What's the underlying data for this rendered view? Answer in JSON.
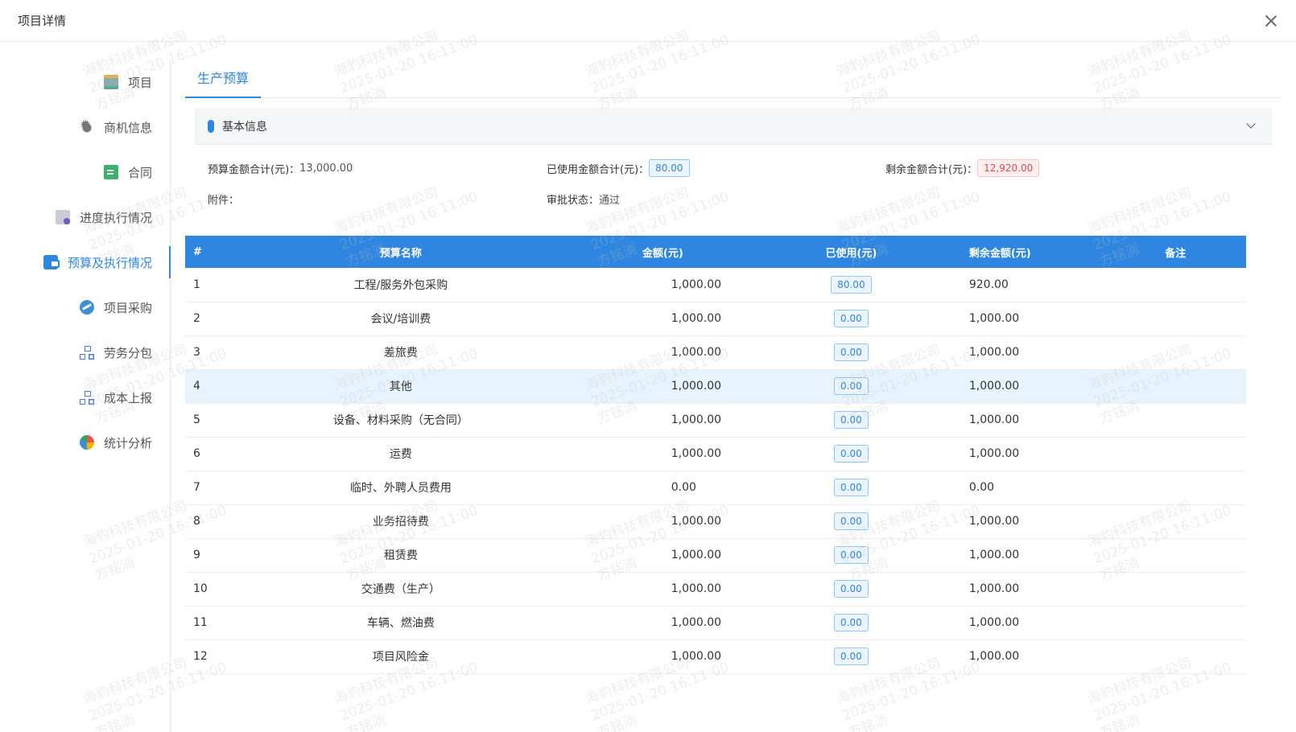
{
  "header": {
    "title": "项目详情"
  },
  "sidebar": {
    "items": [
      {
        "label": "项目",
        "icon": "book-icon"
      },
      {
        "label": "商机信息",
        "icon": "bug-icon"
      },
      {
        "label": "合同",
        "icon": "document-icon"
      },
      {
        "label": "进度执行情况",
        "icon": "list-icon"
      },
      {
        "label": "预算及执行情况",
        "icon": "wallet-icon",
        "active": true
      },
      {
        "label": "项目采购",
        "icon": "purchase-icon"
      },
      {
        "label": "劳务分包",
        "icon": "org-chart-icon"
      },
      {
        "label": "成本上报",
        "icon": "org-chart-icon"
      },
      {
        "label": "统计分析",
        "icon": "pie-chart-icon"
      }
    ]
  },
  "tabs": [
    {
      "label": "生产预算"
    }
  ],
  "section": {
    "title": "基本信息"
  },
  "info": {
    "budget_total_label": "预算金额合计(元)：",
    "budget_total_value": "13,000.00",
    "used_total_label": "已使用金额合计(元)：",
    "used_total_value": "80.00",
    "remaining_total_label": "剩余金额合计(元)：",
    "remaining_total_value": "12,920.00",
    "attachment_label": "附件：",
    "approval_label": "审批状态：",
    "approval_value": "通过"
  },
  "table": {
    "columns": [
      "#",
      "预算名称",
      "金额(元)",
      "已使用(元)",
      "剩余金额(元)",
      "备注"
    ],
    "rows": [
      {
        "idx": "1",
        "name": "工程/服务外包采购",
        "amount": "1,000.00",
        "used": "80.00",
        "remaining": "920.00",
        "note": ""
      },
      {
        "idx": "2",
        "name": "会议/培训费",
        "amount": "1,000.00",
        "used": "0.00",
        "remaining": "1,000.00",
        "note": ""
      },
      {
        "idx": "3",
        "name": "差旅费",
        "amount": "1,000.00",
        "used": "0.00",
        "remaining": "1,000.00",
        "note": ""
      },
      {
        "idx": "4",
        "name": "其他",
        "amount": "1,000.00",
        "used": "0.00",
        "remaining": "1,000.00",
        "note": ""
      },
      {
        "idx": "5",
        "name": "设备、材料采购（无合同）",
        "amount": "1,000.00",
        "used": "0.00",
        "remaining": "1,000.00",
        "note": ""
      },
      {
        "idx": "6",
        "name": "运费",
        "amount": "1,000.00",
        "used": "0.00",
        "remaining": "1,000.00",
        "note": ""
      },
      {
        "idx": "7",
        "name": "临时、外聘人员费用",
        "amount": "0.00",
        "used": "0.00",
        "remaining": "0.00",
        "note": ""
      },
      {
        "idx": "8",
        "name": "业务招待费",
        "amount": "1,000.00",
        "used": "0.00",
        "remaining": "1,000.00",
        "note": ""
      },
      {
        "idx": "9",
        "name": "租赁费",
        "amount": "1,000.00",
        "used": "0.00",
        "remaining": "1,000.00",
        "note": ""
      },
      {
        "idx": "10",
        "name": "交通费（生产）",
        "amount": "1,000.00",
        "used": "0.00",
        "remaining": "1,000.00",
        "note": ""
      },
      {
        "idx": "11",
        "name": "车辆、燃油费",
        "amount": "1,000.00",
        "used": "0.00",
        "remaining": "1,000.00",
        "note": ""
      },
      {
        "idx": "12",
        "name": "项目风险金",
        "amount": "1,000.00",
        "used": "0.00",
        "remaining": "1,000.00",
        "note": ""
      }
    ],
    "highlight_row": 3
  },
  "watermark": {
    "company": "海豹科技有限公司",
    "time": "2025-01-20 16:11:00",
    "user": "方铭淌"
  },
  "colors": {
    "accent": "#2f86e0",
    "danger": "#e02424",
    "header_bg": "#2f86e0"
  }
}
